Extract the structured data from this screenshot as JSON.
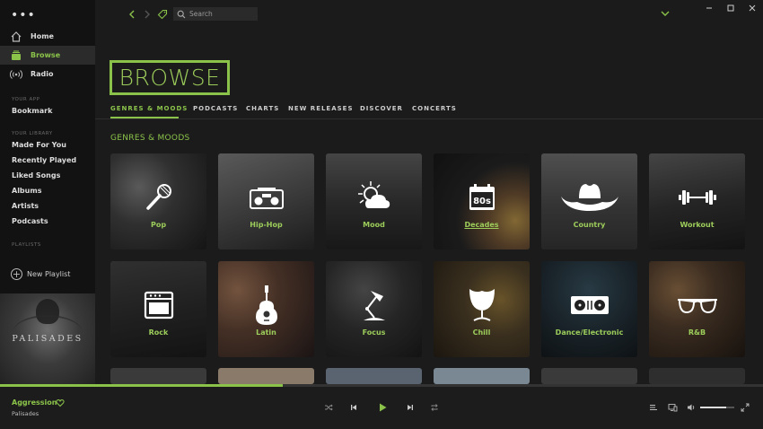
{
  "sidebar": {
    "nav": [
      {
        "label": "Home",
        "icon": "home-icon"
      },
      {
        "label": "Browse",
        "icon": "browse-icon",
        "active": true
      },
      {
        "label": "Radio",
        "icon": "radio-icon"
      }
    ],
    "your_app_heading": "YOUR APP",
    "your_app_items": [
      "Bookmark"
    ],
    "library_heading": "YOUR LIBRARY",
    "library_items": [
      "Made For You",
      "Recently Played",
      "Liked Songs",
      "Albums",
      "Artists",
      "Podcasts"
    ],
    "playlists_heading": "PLAYLISTS",
    "new_playlist_label": "New Playlist",
    "album_art_text": "PALISADES"
  },
  "topbar": {
    "search_placeholder": "Search"
  },
  "browse": {
    "title": "BROWSE",
    "tabs": [
      "GENRES & MOODS",
      "PODCASTS",
      "CHARTS",
      "NEW RELEASES",
      "DISCOVER",
      "CONCERTS"
    ],
    "active_tab": 0,
    "section_title": "GENRES & MOODS",
    "tiles": [
      {
        "label": "Pop",
        "icon": "microphone-icon"
      },
      {
        "label": "Hip-Hop",
        "icon": "boombox-icon"
      },
      {
        "label": "Mood",
        "icon": "sun-cloud-icon"
      },
      {
        "label": "Decades",
        "icon": "calendar-80s-icon",
        "hovered": true
      },
      {
        "label": "Country",
        "icon": "cowboy-hat-icon"
      },
      {
        "label": "Workout",
        "icon": "dumbbell-icon"
      },
      {
        "label": "Rock",
        "icon": "amplifier-icon"
      },
      {
        "label": "Latin",
        "icon": "guitar-icon"
      },
      {
        "label": "Focus",
        "icon": "desk-lamp-icon"
      },
      {
        "label": "Chill",
        "icon": "egg-chair-icon"
      },
      {
        "label": "Dance/Electronic",
        "icon": "dj-mixer-icon"
      },
      {
        "label": "R&B",
        "icon": "sunglasses-icon"
      }
    ]
  },
  "player": {
    "track_title": "Aggression",
    "artist": "Palisades",
    "progress": 0.37,
    "volume": 0.75
  },
  "colors": {
    "accent": "#8bc34a",
    "sidebar_bg": "#121212",
    "main_bg": "#1b1b1b"
  }
}
